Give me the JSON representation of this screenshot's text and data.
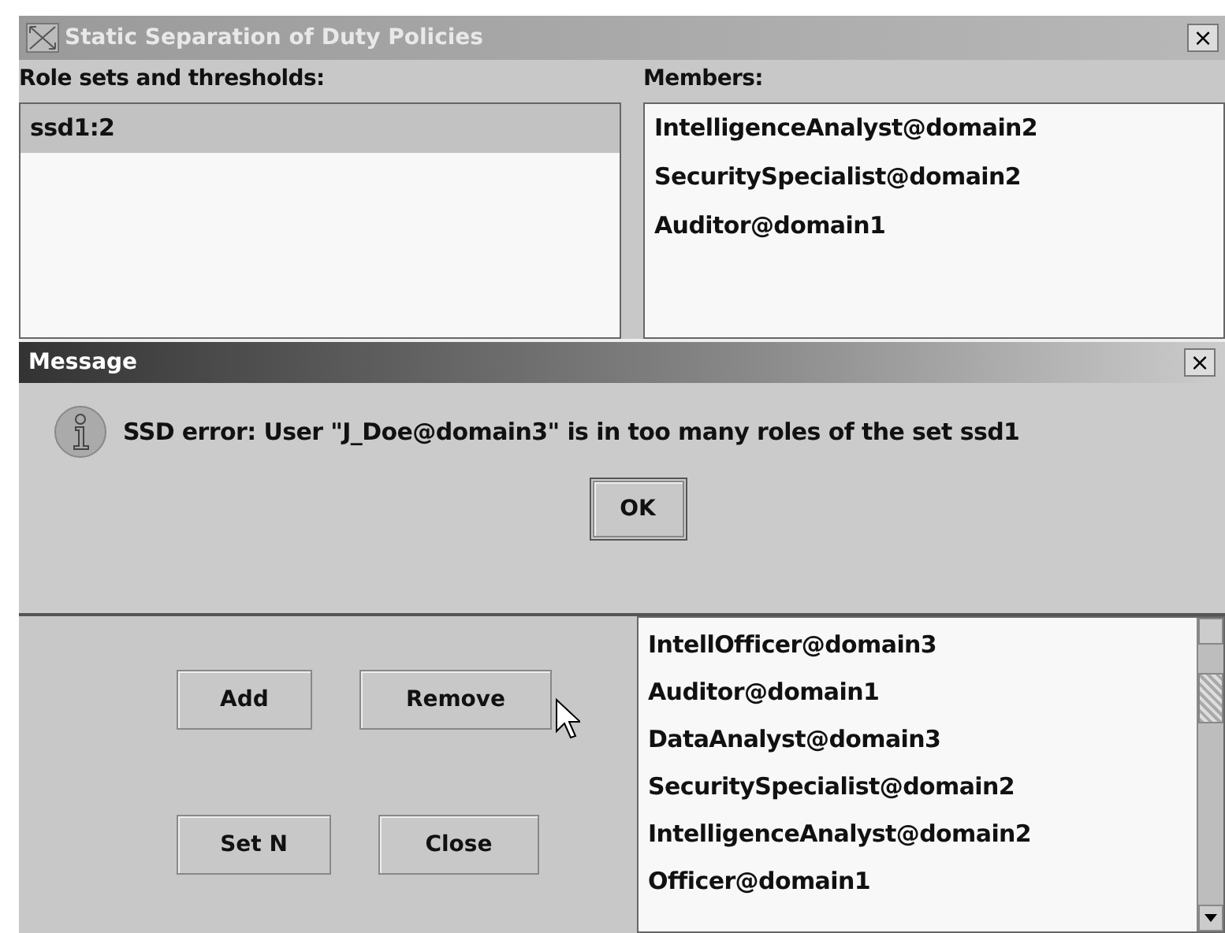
{
  "window": {
    "title": "Static Separation of Duty Policies",
    "close": "×"
  },
  "role_sets": {
    "label": "Role sets and thresholds:",
    "items": [
      {
        "text": "ssd1:2",
        "selected": true
      }
    ]
  },
  "members": {
    "label": "Members:",
    "items": [
      {
        "text": "IntelligenceAnalyst@domain2",
        "selected": false
      },
      {
        "text": "SecuritySpecialist@domain2",
        "selected": false
      },
      {
        "text": "Auditor@domain1",
        "selected": false
      }
    ]
  },
  "message_dialog": {
    "title": "Message",
    "close": "×",
    "text": "SSD error: User \"J_Doe@domain3\" is in too many roles of the set ssd1",
    "button": "OK"
  },
  "buttons": [
    [
      "Add",
      "Remove"
    ],
    [
      "Set N",
      "Close"
    ]
  ],
  "roles": {
    "items": [
      {
        "text": "IntellOfficer@domain3",
        "selected": false
      },
      {
        "text": "Auditor@domain1",
        "selected": false
      },
      {
        "text": "DataAnalyst@domain3",
        "selected": false
      },
      {
        "text": "SecuritySpecialist@domain2",
        "selected": false
      },
      {
        "text": "IntelligenceAnalyst@domain2",
        "selected": false
      },
      {
        "text": "Officer@domain1",
        "selected": false
      }
    ]
  }
}
